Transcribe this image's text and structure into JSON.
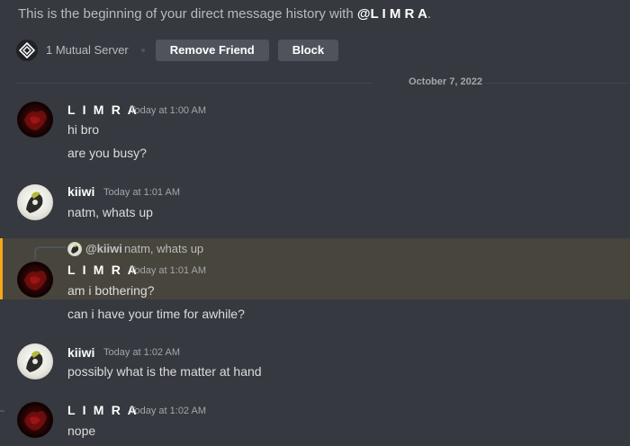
{
  "intro": {
    "prefix": "This is the beginning of your direct message history with ",
    "username": "@L I M R A",
    "suffix": "."
  },
  "mutual": {
    "label": "1 Mutual Server",
    "remove_friend_label": "Remove Friend",
    "block_label": "Block"
  },
  "date_divider": "October 7, 2022",
  "messages": [
    {
      "author": "L I M R A",
      "time": "Today at 1:00 AM",
      "lines": [
        "hi bro",
        "are you busy?"
      ],
      "avatar": "dark-red-avatar"
    },
    {
      "author": "kiiwi",
      "time": "Today at 1:01 AM",
      "lines": [
        "natm, whats up"
      ],
      "avatar": "white-creature-avatar"
    },
    {
      "reply": {
        "author": "@kiiwi",
        "text": "natm, whats up"
      },
      "author": "L I M R A",
      "time": "Today at 1:01 AM",
      "lines": [
        "am i bothering?",
        "can i have your time for awhile?"
      ],
      "avatar": "dark-red-avatar"
    },
    {
      "author": "kiiwi",
      "time": "Today at 1:02 AM",
      "lines": [
        "possibly what is the matter at hand"
      ],
      "avatar": "white-creature-avatar"
    },
    {
      "author": "L I M R A",
      "time": "Today at 1:02 AM",
      "lines": [
        "nope"
      ],
      "avatar": "dark-red-avatar"
    }
  ],
  "colors": {
    "background": "#36393f",
    "mention_highlight": "#48453c",
    "mention_bar": "#faa81a",
    "button": "#4f545c"
  }
}
